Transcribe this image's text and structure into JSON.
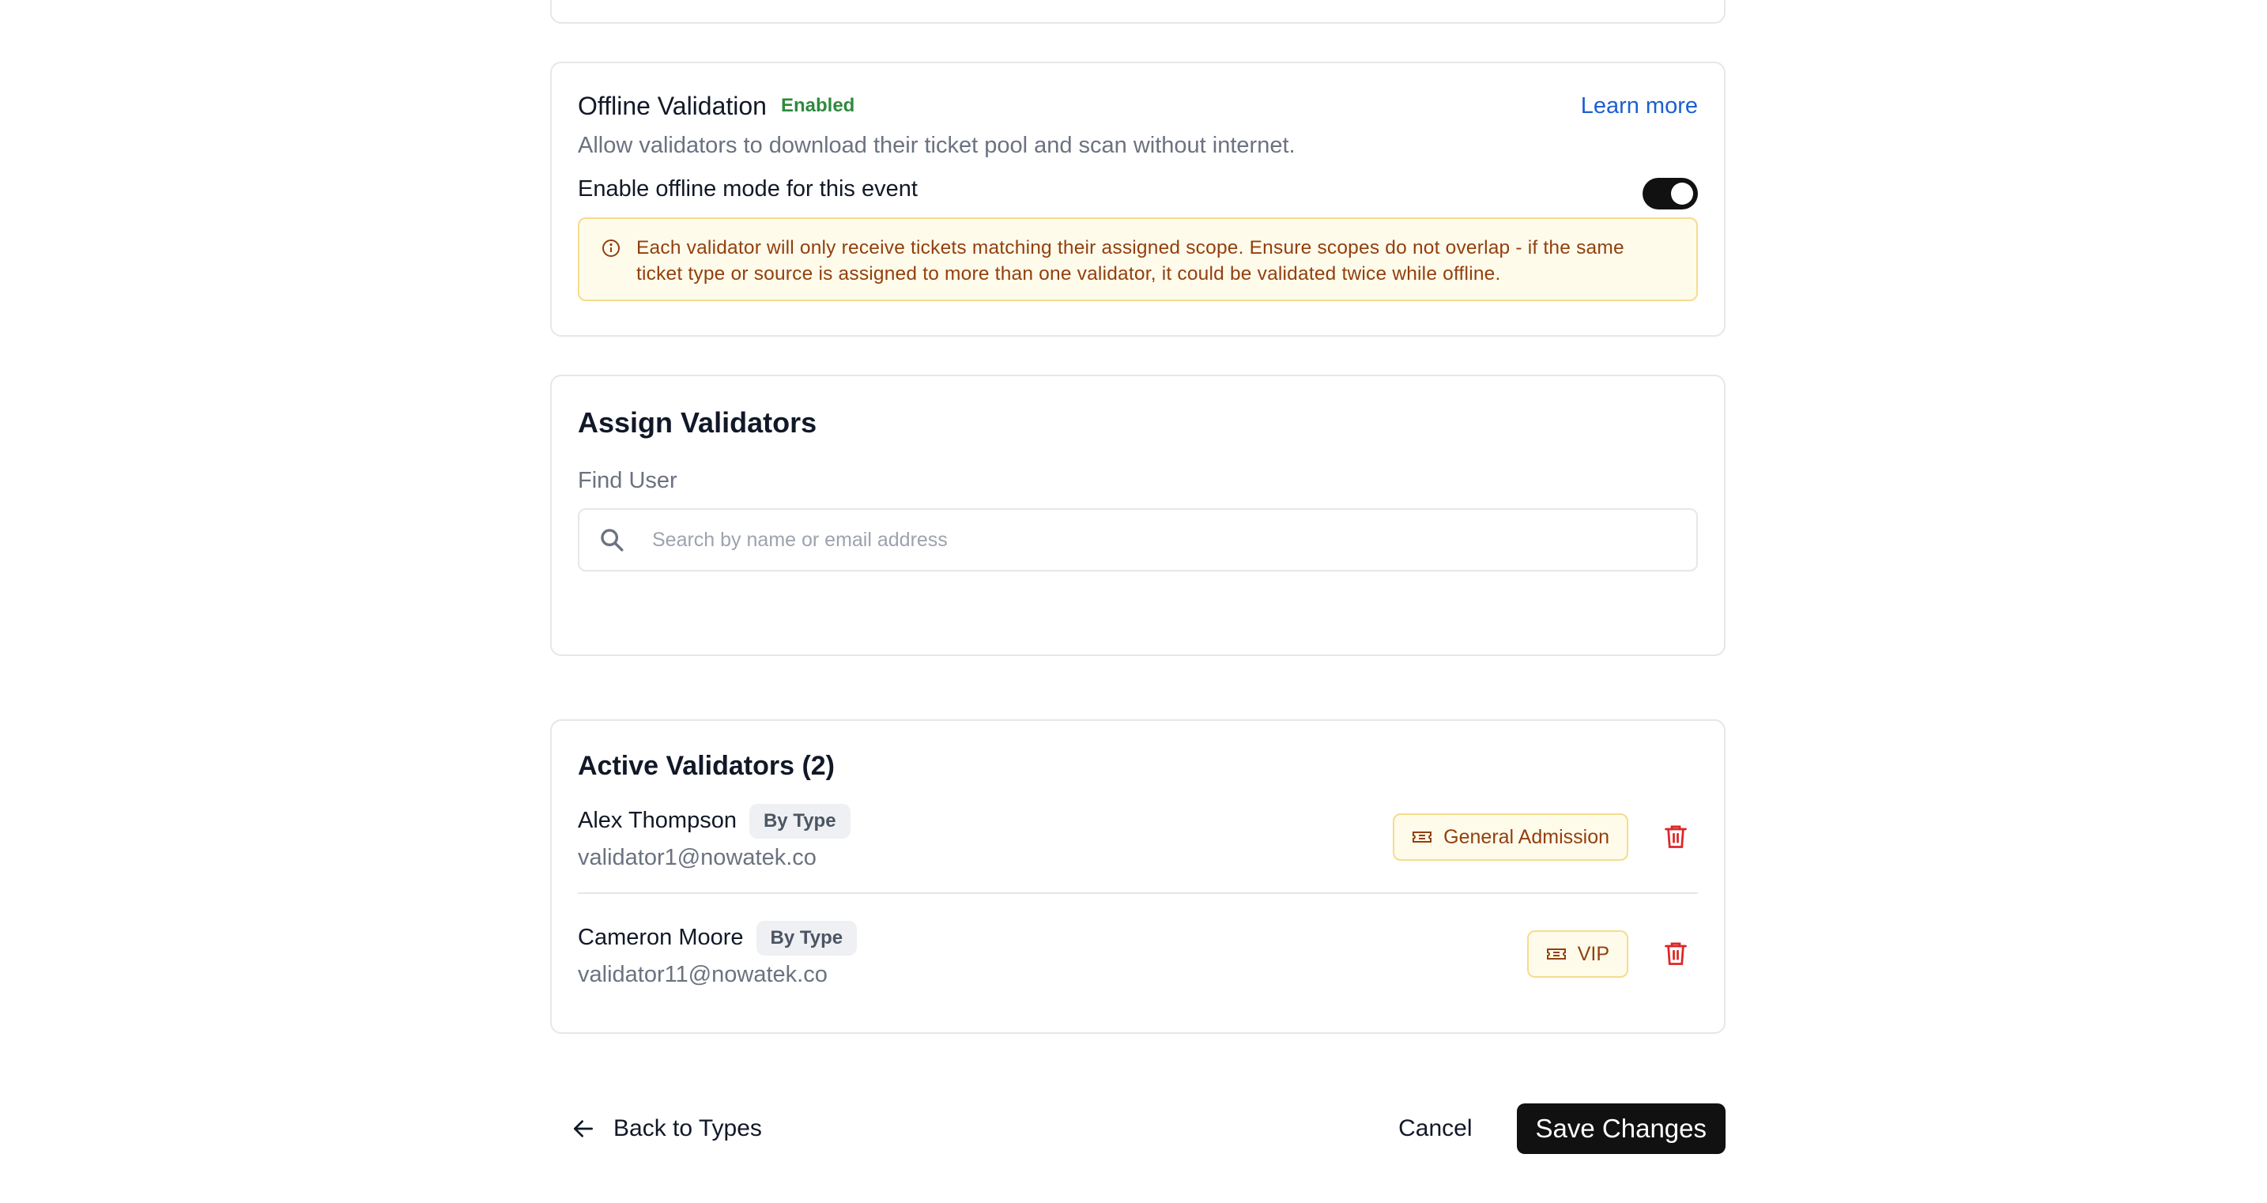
{
  "offline_validation": {
    "title": "Offline Validation",
    "status_badge": "Enabled",
    "learn_more": "Learn more",
    "description": "Allow validators to download their ticket pool and scan without internet.",
    "toggle_label": "Enable offline mode for this event",
    "toggle_on": true,
    "warning": "Each validator will only receive tickets matching their assigned scope. Ensure scopes do not overlap - if the same ticket type or source is assigned to more than one validator, it could be validated twice while offline."
  },
  "assign_validators": {
    "title": "Assign Validators",
    "find_label": "Find User",
    "search_placeholder": "Search by name or email address",
    "search_value": ""
  },
  "active_validators": {
    "title": "Active Validators (2)",
    "items": [
      {
        "name": "Alex Thompson",
        "scope_type": "By Type",
        "email": "validator1@nowatek.co",
        "scope_tag": "General Admission"
      },
      {
        "name": "Cameron Moore",
        "scope_type": "By Type",
        "email": "validator11@nowatek.co",
        "scope_tag": "VIP"
      }
    ]
  },
  "footer": {
    "back_label": "Back to Types",
    "cancel_label": "Cancel",
    "save_label": "Save Changes"
  },
  "colors": {
    "accent": "#111111",
    "link": "#1d5fd0",
    "enabled": "#2f8a3e",
    "warning_text": "#92400e",
    "warning_bg": "#fffbeb",
    "danger": "#dc2626"
  },
  "icons": {
    "info": "info-circle-icon",
    "search": "search-icon",
    "ticket": "ticket-icon",
    "delete": "trash-icon",
    "back": "arrow-left-icon"
  }
}
